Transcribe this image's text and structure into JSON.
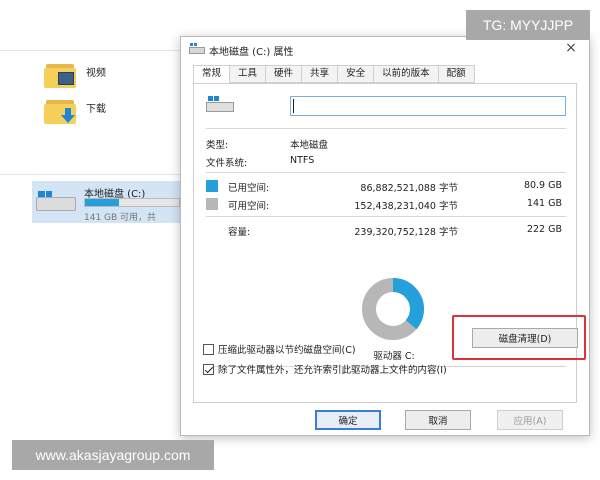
{
  "explorer": {
    "items": [
      {
        "label": "视频"
      },
      {
        "label": "下载"
      }
    ],
    "drive": {
      "name": "本地磁盘 (C:)",
      "free_text": "141 GB 可用，共",
      "used_fraction": 0.363
    }
  },
  "dialog": {
    "title": "本地磁盘 (C:) 属性",
    "close_glyph": "×",
    "tabs": [
      "常规",
      "工具",
      "硬件",
      "共享",
      "安全",
      "以前的版本",
      "配额"
    ],
    "active_tab": 0,
    "name_value": "",
    "type_label": "类型:",
    "type_value": "本地磁盘",
    "fs_label": "文件系统:",
    "fs_value": "NTFS",
    "used": {
      "label": "已用空间:",
      "bytes": "86,882,521,088 字节",
      "size": "80.9 GB",
      "color": "#26a0da"
    },
    "free": {
      "label": "可用空间:",
      "bytes": "152,438,231,040 字节",
      "size": "141 GB",
      "color": "#b7b7b7"
    },
    "capacity": {
      "label": "容量:",
      "bytes": "239,320,752,128 字节",
      "size": "222 GB"
    },
    "drive_label": "驱动器 C:",
    "cleanup_button": "磁盘清理(D)",
    "checkbox_compress": {
      "label": "压缩此驱动器以节约磁盘空间(C)",
      "checked": false
    },
    "checkbox_index": {
      "label": "除了文件属性外，还允许索引此驱动器上文件的内容(I)",
      "checked": true
    },
    "buttons": {
      "ok": "确定",
      "cancel": "取消",
      "apply": "应用(A)"
    }
  },
  "watermarks": {
    "tg": "TG: MYYJJPP",
    "url": "www.akasjayagroup.com"
  },
  "colors": {
    "highlight": "#d9343a",
    "accent": "#26a0da"
  }
}
